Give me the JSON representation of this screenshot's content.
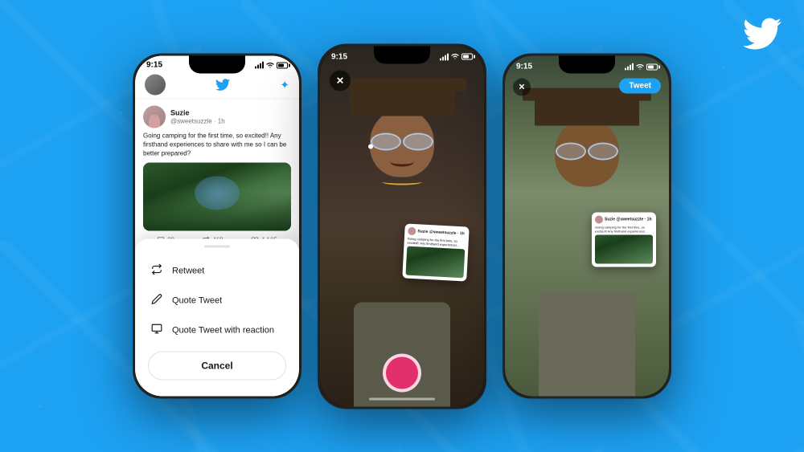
{
  "bg": {
    "color": "#1DA1F2"
  },
  "twitter_logo": {
    "label": "Twitter bird logo"
  },
  "phone1": {
    "status_time": "9:15",
    "twitter_header_label": "Twitter header",
    "author_name": "Suzie",
    "author_handle": "@sweetsuzzle · 1h",
    "tweet_text": "Going camping for the first time, so excited!! Any firsthand experiences to share with me so I can be better prepared?",
    "action_comment": "38",
    "action_retweet": "468",
    "action_like": "4,105",
    "menu": {
      "retweet": "Retweet",
      "quote_tweet": "Quote Tweet",
      "quote_with_reaction": "Quote Tweet with reaction",
      "cancel": "Cancel"
    }
  },
  "phone2": {
    "status_time": "9:15",
    "close_label": "✕",
    "floating_tweet": {
      "author": "Suzie @sweetsuzzle · 1h",
      "text": "Going camping for the first time, so excited!! Any firsthand experiences..."
    }
  },
  "phone3": {
    "status_time": "9:15",
    "close_label": "✕",
    "tweet_button": "Tweet",
    "floating_tweet": {
      "author": "Suzie @sweetsuzzle · 1h",
      "text": "Going camping for the first time, so excited!! Any firsthand experiences..."
    }
  }
}
